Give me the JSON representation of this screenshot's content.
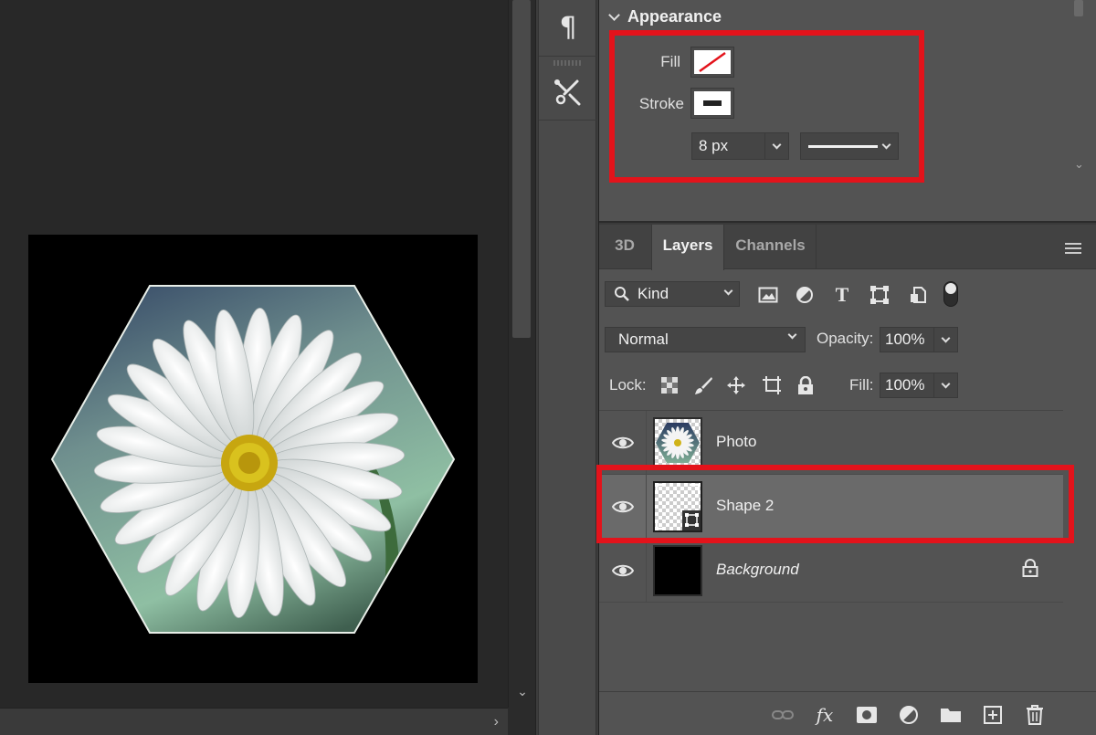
{
  "properties": {
    "section_title": "Appearance",
    "fill_label": "Fill",
    "stroke_label": "Stroke",
    "stroke_size": "8 px"
  },
  "layers_panel": {
    "tabs": [
      "3D",
      "Layers",
      "Channels"
    ],
    "active_tab": "Layers",
    "filter_kind": "Kind",
    "blend_mode": "Normal",
    "opacity_label": "Opacity:",
    "opacity_value": "100%",
    "lock_label": "Lock:",
    "fill_label": "Fill:",
    "fill_value": "100%",
    "layers": [
      {
        "name": "Photo",
        "visible": true
      },
      {
        "name": "Shape 2",
        "visible": true,
        "selected": true
      },
      {
        "name": "Background",
        "visible": true,
        "locked": true
      }
    ],
    "footer_icons": [
      "link-icon",
      "fx-icon",
      "mask-icon",
      "adjustment-icon",
      "folder-icon",
      "new-layer-icon",
      "trash-icon"
    ]
  },
  "colors": {
    "highlight": "#e3131b",
    "panel_bg": "#535353",
    "selected_row": "#6a6a6a"
  }
}
